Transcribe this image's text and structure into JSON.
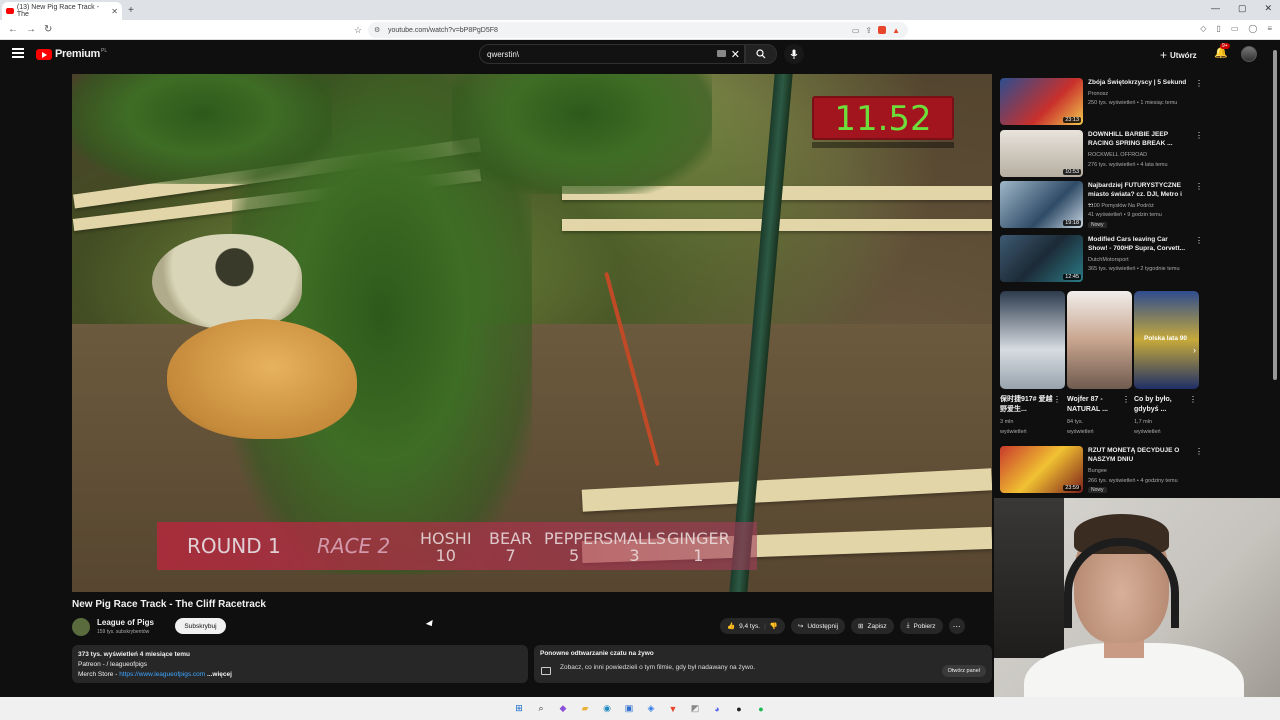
{
  "browser": {
    "tab_title": "(13) New Pig Race Track - The",
    "url": "youtube.com/watch?v=bP8PgD5F8"
  },
  "header": {
    "logo_text": "Premium",
    "logo_sup": "PL",
    "search_value": "qwerstin\\",
    "create_label": "Utwórz",
    "notif_count": "9+"
  },
  "video": {
    "timer": "11.52",
    "round": "ROUND 1",
    "race": "RACE 2",
    "racers": [
      {
        "name": "HOSHI",
        "score": "10"
      },
      {
        "name": "BEAR",
        "score": "7"
      },
      {
        "name": "PEPPER",
        "score": "5"
      },
      {
        "name": "SMALLS",
        "score": "3"
      },
      {
        "name": "GINGER",
        "score": "1"
      }
    ],
    "title": "New Pig Race Track - The Cliff Racetrack"
  },
  "channel": {
    "name": "League of Pigs",
    "subs": "159 tys. subskrybentów",
    "subscribe_label": "Subskrybuj"
  },
  "actions": {
    "likes": "9,4 tys.",
    "share": "Udostępnij",
    "save": "Zapisz",
    "download": "Pobierz"
  },
  "description": {
    "stats": "373 tys. wyświetleń  4 miesiące temu",
    "patreon": "Patreon - ",
    "patreon_handle": "/ leagueofpigs",
    "merch_label": "Merch Store - ",
    "merch_url": "https://www.leagueofpigs.com",
    "more": "...więcej"
  },
  "chat_replay": {
    "title": "Ponowne odtwarzanie czatu na żywo",
    "text": "Zobacz, co inni powiedzieli o tym filmie, gdy był nadawany na żywo.",
    "open_label": "Otwórz panel"
  },
  "recommendations": [
    {
      "title": "Zbója Świętokrzyscy | 5 Sekund",
      "channel": "Pronosz",
      "meta": "250 tys. wyświetleń • 1 miesiąc temu",
      "duration": "23:13",
      "new": ""
    },
    {
      "title": "DOWNHILL BARBIE JEEP RACING SPRING BREAK ...",
      "channel": "ROCKWELL OFFROAD",
      "meta": "276 tys. wyświetleń • 4 lata temu",
      "duration": "10:53",
      "new": ""
    },
    {
      "title": "Najbardziej FUTURYSTYCZNE miasto świata? cz. DJI, Metro i ...",
      "channel": "1100 Pomysłów Na Podróż",
      "meta": "41 wyświetleń • 9 godzin temu",
      "duration": "19:18",
      "new": "Nowy"
    },
    {
      "title": "Modified Cars leaving Car Show! - 700HP Supra, Corvett...",
      "channel": "DutchMotorsport",
      "meta": "365 tys. wyświetleń • 2 tygodnie temu",
      "duration": "12:45",
      "new": ""
    },
    {
      "title": "RZUT MONETĄ DECYDUJE O NASZYM DNIU",
      "channel": "Bungee",
      "meta": "266 tys. wyświetleń • 4 godziny temu",
      "duration": "23:59",
      "new": "Nowy"
    }
  ],
  "shorts": [
    {
      "title": "保时捷917# 爱越野爱生...",
      "views": "3 mln",
      "label": "wyświetleń",
      "overlay": ""
    },
    {
      "title": "Wojfer 87 - NATURAL ...",
      "views": "84 tys.",
      "label": "wyświetleń",
      "overlay": ""
    },
    {
      "title": "Co by było, gdybyś ...",
      "views": "1,7 mln",
      "label": "wyświetleń",
      "overlay": "Polska lata 90"
    }
  ],
  "colors": {
    "accent": "#ff0000",
    "timer_green": "#6dde3a",
    "timer_bg": "#a2151f"
  }
}
